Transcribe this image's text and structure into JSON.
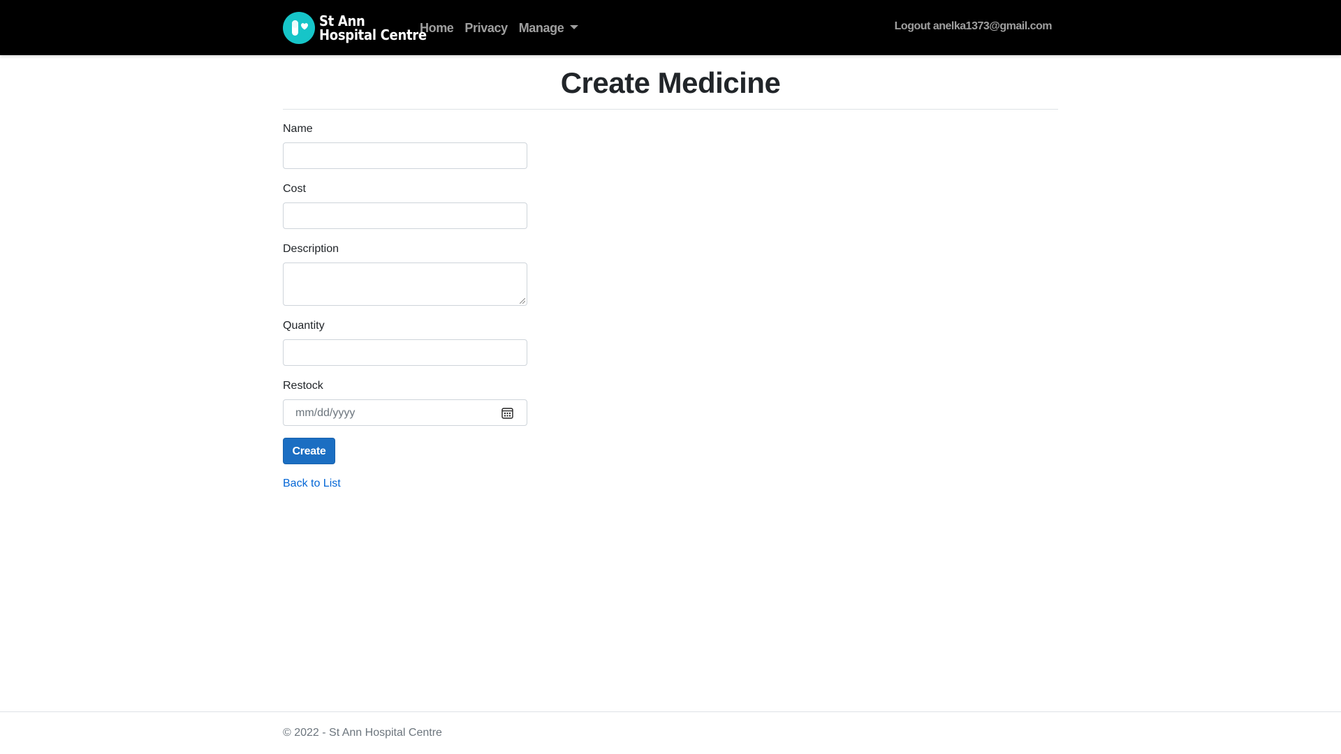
{
  "navbar": {
    "brand_line1": "St Ann",
    "brand_line2": "Hospital Centre",
    "links": [
      "Home",
      "Privacy",
      "Manage"
    ],
    "logout_label": "Logout",
    "user_email": "anelka1373@gmail.com",
    "background": "#000000",
    "logo_color": "#16c5c8"
  },
  "page": {
    "title": "Create Medicine"
  },
  "form": {
    "name_label": "Name",
    "name_value": "",
    "cost_label": "Cost",
    "cost_value": "",
    "description_label": "Description",
    "description_value": "",
    "quantity_label": "Quantity",
    "quantity_value": "",
    "restock_label": "Restock",
    "restock_placeholder": "mm/dd/yyyy",
    "create_button": "Create",
    "back_link": "Back to List",
    "button_color": "#1b6ec2",
    "link_color": "#0366d6"
  },
  "footer": {
    "text": "© 2022 - St Ann Hospital Centre"
  },
  "icons": {
    "logo": "capsule-heart-icon",
    "dropdown": "caret-down-icon",
    "calendar": "calendar-icon"
  }
}
